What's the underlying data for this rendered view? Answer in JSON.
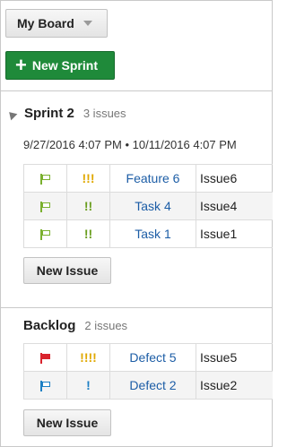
{
  "header": {
    "board_label": "My Board",
    "new_sprint_label": "New Sprint",
    "new_sprint_icon": "plus-icon"
  },
  "sprint": {
    "title": "Sprint 2",
    "count": "3 issues",
    "dates": "9/27/2016 4:07 PM • 10/11/2016 4:07 PM",
    "rows": [
      {
        "type_icon": "flag-outline-green",
        "priority": "!!!",
        "priority_color": "#e0a800",
        "name": "Feature 6",
        "id": "Issue6"
      },
      {
        "type_icon": "flag-outline-green",
        "priority": "!!",
        "priority_color": "#6a9e1f",
        "name": "Task 4",
        "id": "Issue4"
      },
      {
        "type_icon": "flag-outline-green",
        "priority": "!!",
        "priority_color": "#6a9e1f",
        "name": "Task 1",
        "id": "Issue1"
      }
    ],
    "new_issue_label": "New Issue"
  },
  "backlog": {
    "title": "Backlog",
    "count": "2 issues",
    "rows": [
      {
        "type_icon": "flag-filled-red",
        "priority": "!!!!",
        "priority_color": "#e0a800",
        "name": "Defect 5",
        "id": "Issue5"
      },
      {
        "type_icon": "flag-outline-blue",
        "priority": "!",
        "priority_color": "#1c7fc4",
        "name": "Defect 2",
        "id": "Issue2"
      }
    ],
    "new_issue_label": "New Issue"
  },
  "colors": {
    "accent_green": "#1f8a3a",
    "link_blue": "#1c5da6",
    "flag_green": "#7ab02e",
    "flag_red": "#d9232d",
    "flag_blue": "#1c7fc4"
  }
}
